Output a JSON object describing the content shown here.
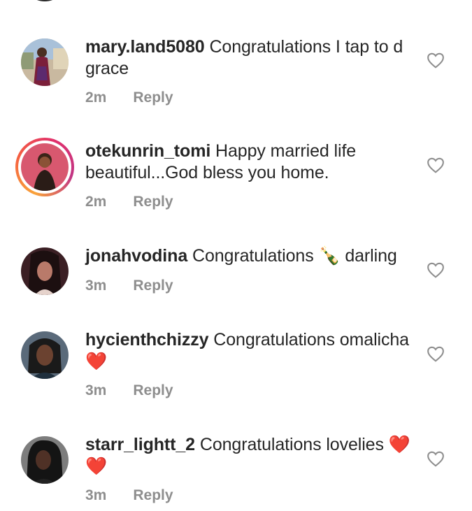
{
  "comments": [
    {
      "username": "mary.land5080",
      "text": "Congratulations I tap to d grace",
      "time": "2m",
      "reply": "Reply",
      "avatar_icon": "profile-photo"
    },
    {
      "username": "otekunrin_tomi",
      "text": "Happy married life beautiful...God bless you home.",
      "time": "2m",
      "reply": "Reply",
      "avatar_icon": "profile-photo-story-ring"
    },
    {
      "username": "jonahvodina",
      "text": "Congratulations 🍾 darling",
      "time": "3m",
      "reply": "Reply",
      "avatar_icon": "profile-photo"
    },
    {
      "username": "hycienthchizzy",
      "text": "Congratulations omalicha ❤️",
      "time": "3m",
      "reply": "Reply",
      "avatar_icon": "profile-photo"
    },
    {
      "username": "starr_lightt_2",
      "text": "Congratulations lovelies ❤️❤️",
      "time": "3m",
      "reply": "Reply",
      "avatar_icon": "profile-photo"
    }
  ],
  "colors": {
    "text": "#262626",
    "meta": "#8e8e8e",
    "heart_outline": "#8e8e8e",
    "story_ring": [
      "#f9a33a",
      "#e1306c",
      "#c13584"
    ]
  }
}
